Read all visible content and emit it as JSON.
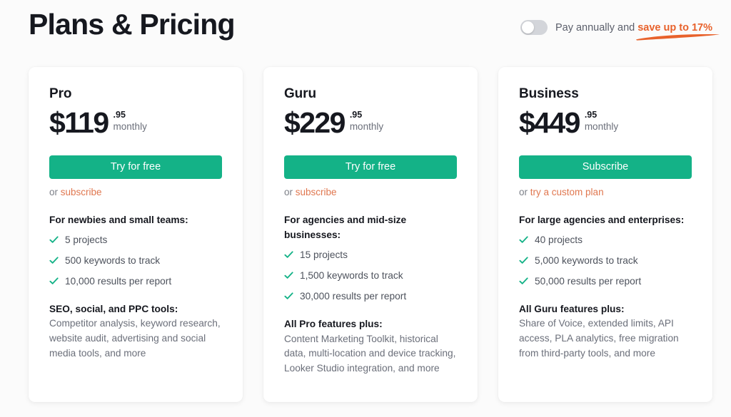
{
  "header": {
    "title": "Plans & Pricing",
    "billing": {
      "toggle_state": "off",
      "toggle_name": "annual-billing-toggle",
      "text_prefix": "Pay annually and",
      "save_label": "save up to 17%",
      "accent_color": "#e8622c"
    }
  },
  "theme": {
    "green": "#14b287",
    "orange": "#e8622c",
    "link_orange": "#e0774f",
    "page_bg": "#fbfbfb",
    "card_bg": "#ffffff"
  },
  "plans": [
    {
      "name": "Pro",
      "price_main": "$119",
      "price_cents": ".95",
      "price_period": "monthly",
      "cta_label": "Try for free",
      "cta_icon": "none",
      "secondary_prefix": "or",
      "secondary_link": "subscribe",
      "audience": "For newbies and small teams:",
      "features": [
        "5 projects",
        "500 keywords to track",
        "10,000 results per report"
      ],
      "extra_title": "SEO, social, and PPC tools:",
      "extra_desc": "Competitor analysis, keyword research, website audit, advertising and social media tools, and more"
    },
    {
      "name": "Guru",
      "price_main": "$229",
      "price_cents": ".95",
      "price_period": "monthly",
      "cta_label": "Try for free",
      "cta_icon": "none",
      "secondary_prefix": "or",
      "secondary_link": "subscribe",
      "audience": "For agencies and mid-size businesses:",
      "features": [
        "15 projects",
        "1,500 keywords to track",
        "30,000 results per report"
      ],
      "extra_title": "All Pro features plus:",
      "extra_desc": "Content Marketing Toolkit, historical data, multi-location and device tracking, Looker Studio integration, and more"
    },
    {
      "name": "Business",
      "price_main": "$449",
      "price_cents": ".95",
      "price_period": "monthly",
      "cta_label": "Subscribe",
      "cta_icon": "none",
      "secondary_prefix": "or",
      "secondary_link": "try a custom plan",
      "audience": "For large agencies and enterprises:",
      "features": [
        "40 projects",
        "5,000 keywords to track",
        "50,000 results per report"
      ],
      "extra_title": "All Guru features plus:",
      "extra_desc": "Share of Voice, extended limits, API access, PLA analytics, free migration from third-party tools, and more"
    }
  ]
}
